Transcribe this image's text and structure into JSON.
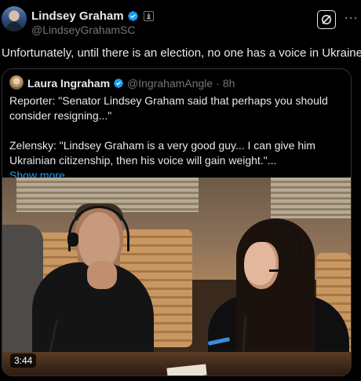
{
  "author": {
    "display_name": "Lindsey Graham",
    "handle": "@LindseyGrahamSC",
    "verified_icon": "verified-badge-icon",
    "gov_badge_icon": "government-badge-icon"
  },
  "header_actions": {
    "grok_icon": "grok-icon",
    "more_label": "···"
  },
  "post": {
    "text": "Unfortunately, until there is an election, no one has a voice in Ukraine."
  },
  "quote": {
    "display_name": "Laura Ingraham",
    "handle": "@IngrahamAngle",
    "separator": "·",
    "time": "8h",
    "line1": "Reporter: \"Senator Lindsey Graham said that perhaps you should consider resigning...\"",
    "line2": "Zelensky: \"Lindsey Graham is a very good guy... I can give him Ukrainian citizenship, then his voice will gain weight.\"...",
    "show_more": "Show more",
    "video": {
      "duration": "3:44"
    }
  },
  "colors": {
    "background": "#000000",
    "text_primary": "#e7e9ea",
    "text_secondary": "#71767b",
    "link": "#1d9bf0",
    "border": "#2f3336",
    "verified": "#1d9bf0"
  }
}
